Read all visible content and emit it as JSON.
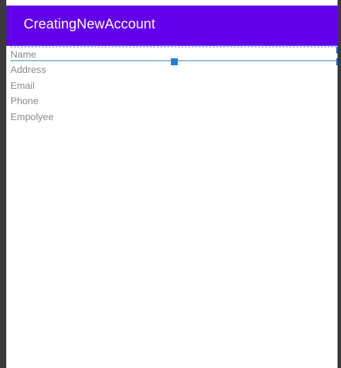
{
  "app_bar": {
    "title": "CreatingNewAccount",
    "color": "#6200ee"
  },
  "form": {
    "fields": [
      {
        "label": "Name"
      },
      {
        "label": "Address"
      },
      {
        "label": "Email"
      },
      {
        "label": "Phone"
      },
      {
        "label": "Empolyee"
      }
    ]
  },
  "selection": {
    "color": "#1e7fe0"
  }
}
